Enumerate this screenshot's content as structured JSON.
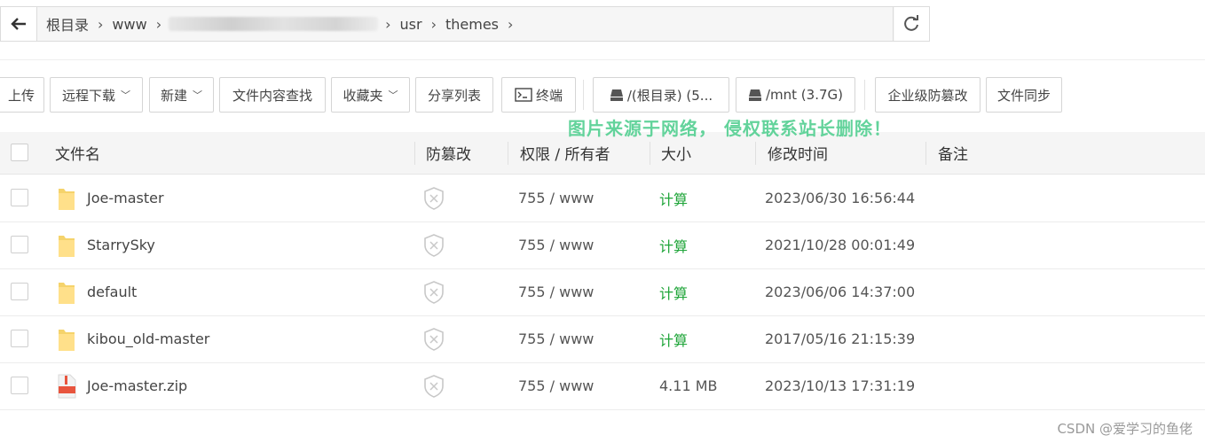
{
  "path": {
    "back_icon": "arrow-left-icon",
    "crumbs": [
      "根目录",
      "www",
      "usr",
      "themes"
    ],
    "refresh_icon": "refresh-icon"
  },
  "toolbar": {
    "upload": "上传",
    "remote_download": "远程下载",
    "new": "新建",
    "search_content": "文件内容查找",
    "favorites": "收藏夹",
    "share_list": "分享列表",
    "terminal": "终端",
    "disk_root": "/(根目录) (5...",
    "disk_mnt": "/mnt (3.7G)",
    "tamper_proof": "企业级防篡改",
    "file_sync": "文件同步"
  },
  "watermark": "图片来源于网络， 侵权联系站长删除！",
  "table": {
    "headers": {
      "name": "文件名",
      "tamper": "防篡改",
      "perm": "权限 / 所有者",
      "size": "大小",
      "mtime": "修改时间",
      "note": "备注"
    },
    "rows": [
      {
        "name": "Joe-master",
        "type": "folder",
        "perm": "755 / www",
        "size": "计算",
        "mtime": "2023/06/30 16:56:44"
      },
      {
        "name": "StarrySky",
        "type": "folder",
        "perm": "755 / www",
        "size": "计算",
        "mtime": "2021/10/28 00:01:49"
      },
      {
        "name": "default",
        "type": "folder",
        "perm": "755 / www",
        "size": "计算",
        "mtime": "2023/06/06 14:37:00"
      },
      {
        "name": "kibou_old-master",
        "type": "folder",
        "perm": "755 / www",
        "size": "计算",
        "mtime": "2017/05/16 21:15:39"
      },
      {
        "name": "Joe-master.zip",
        "type": "zip",
        "perm": "755 / www",
        "size": "4.11 MB",
        "mtime": "2023/10/13 17:31:19"
      }
    ]
  },
  "credit": "CSDN @爱学习的鱼佬",
  "colors": {
    "accent_green": "#20a53a",
    "watermark_green": "#63d39b"
  }
}
